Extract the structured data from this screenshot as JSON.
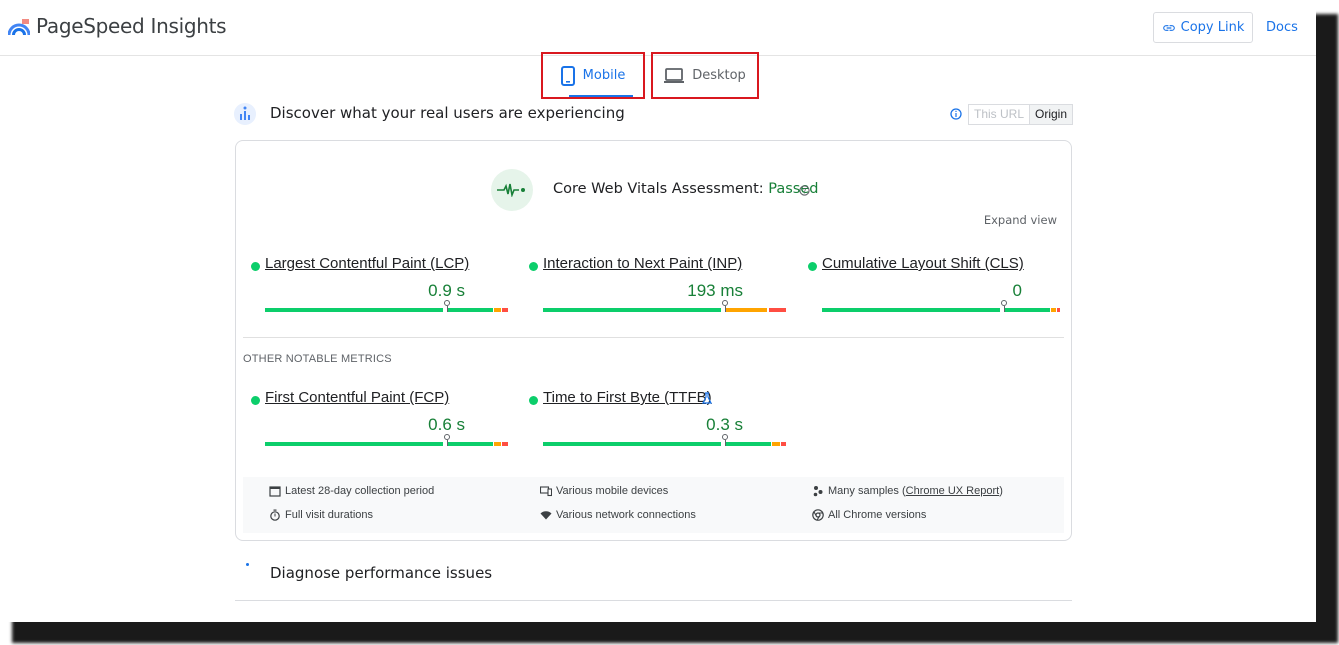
{
  "header": {
    "brand": "PageSpeed Insights",
    "copy_link": "Copy Link",
    "docs": "Docs"
  },
  "tabs": [
    {
      "label": "Mobile",
      "icon": "phone-icon",
      "selected": true
    },
    {
      "label": "Desktop",
      "icon": "laptop-icon",
      "selected": false
    }
  ],
  "crux": {
    "heading": "Discover what your real users are experiencing",
    "toggle": {
      "this_url": "This URL",
      "origin": "Origin",
      "selected": "Origin"
    }
  },
  "assessment": {
    "label": "Core Web Vitals Assessment: ",
    "status": "Passed",
    "expand": "Expand view"
  },
  "core_metrics": [
    {
      "name": "Largest Contentful Paint (LCP)",
      "value": "0.9 s"
    },
    {
      "name": "Interaction to Next Paint (INP)",
      "value": "193 ms"
    },
    {
      "name": "Cumulative Layout Shift (CLS)",
      "value": "0"
    }
  ],
  "other_label": "OTHER NOTABLE METRICS",
  "other_metrics": [
    {
      "name": "First Contentful Paint (FCP)",
      "value": "0.6 s"
    },
    {
      "name": "Time to First Byte (TTFB)",
      "value": "0.3 s"
    }
  ],
  "footer": {
    "period": "Latest 28-day collection period",
    "durations": "Full visit durations",
    "devices": "Various mobile devices",
    "network": "Various network connections",
    "samples_prefix": "Many samples (",
    "samples_link": "Chrome UX Report",
    "samples_suffix": ")",
    "versions": "All Chrome versions"
  },
  "diagnose": "Diagnose performance issues",
  "colors": {
    "good": "#0cce6b",
    "needs_improvement": "#ffa400",
    "poor": "#ff4e42",
    "accent": "#1a73e8",
    "highlight_box": "#d9181f"
  }
}
